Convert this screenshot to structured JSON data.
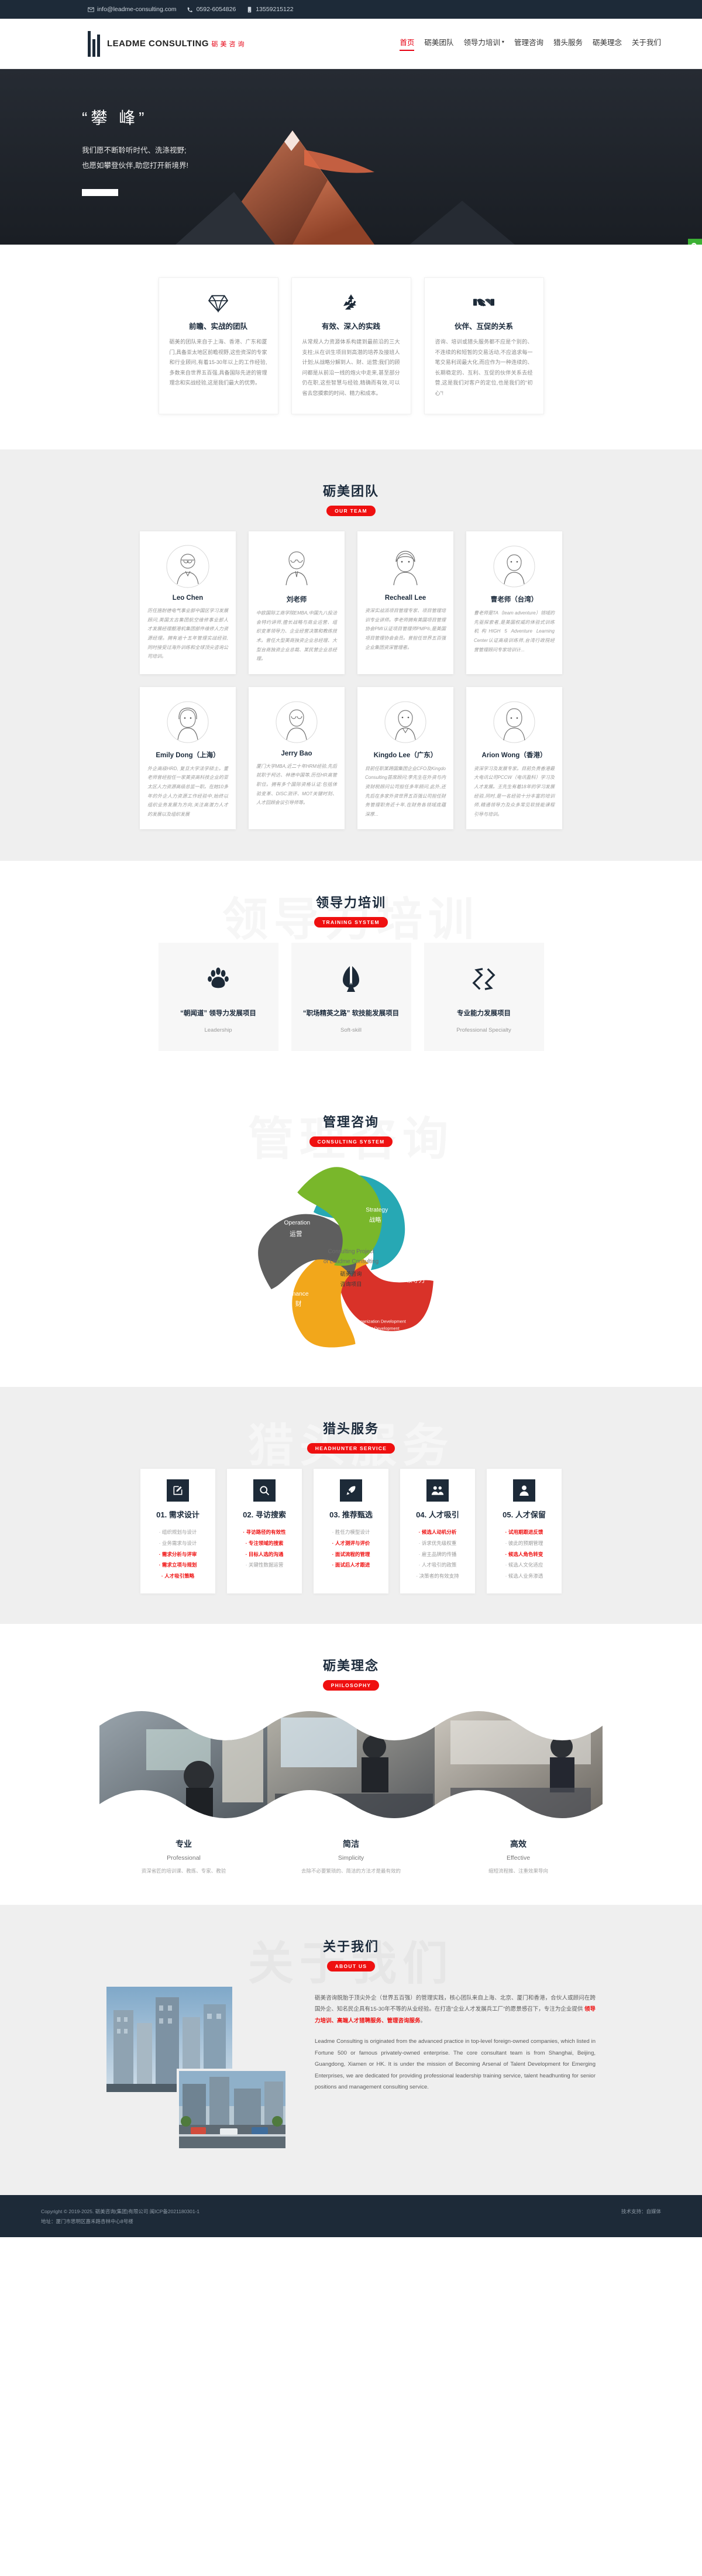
{
  "topbar": {
    "email": "info@leadme-consulting.com",
    "phone": "0592-6054826",
    "mobile": "13559215122"
  },
  "brand": {
    "en": "LEADME CONSULTING",
    "cn": "砺美咨询"
  },
  "nav": [
    {
      "label": "首页",
      "active": true,
      "caret": false
    },
    {
      "label": "砺美团队",
      "active": false,
      "caret": false
    },
    {
      "label": "领导力培训",
      "active": false,
      "caret": true
    },
    {
      "label": "管理咨询",
      "active": false,
      "caret": false
    },
    {
      "label": "猎头服务",
      "active": false,
      "caret": false
    },
    {
      "label": "砺美理念",
      "active": false,
      "caret": false
    },
    {
      "label": "关于我们",
      "active": false,
      "caret": false
    }
  ],
  "hero": {
    "title": "“攀 峰”",
    "line1": "我们愿不断聆听时代、洗涤视野;",
    "line2": "也愿如攀登伙伴,助您打开新境界!"
  },
  "sidefloat": [
    {
      "name": "wechat-icon"
    },
    {
      "name": "qq-icon"
    },
    {
      "name": "phone-icon"
    }
  ],
  "features": [
    {
      "icon": "diamond-icon",
      "title": "前瞻、实战的团队",
      "text": "砺美的团队来自于上海、香港、广东和厦门,具备亚太地区前瞻视野,这些资深的专家和行业顾问,有着15-30年以上的工作经验,多数来自世界五百强,具备国际先进的管理理念和实战经验,这是我们最大的优势。"
    },
    {
      "icon": "recycle-icon",
      "title": "有效、深入的实践",
      "text": "从常规人力资源体系构建到最前沿的三大支柱;从在训生项目到高潜的培养及接班人计划;从战略分解到人、财、运营;我们的顾问都是从前沿一线的炮火中走来,甚至部分仍在职,这些智慧与经验,精确而有效,可以省去您摸索的时间、精力和成本。"
    },
    {
      "icon": "handshake-icon",
      "title": "伙伴、互促的关系",
      "text": "咨询、培训或猎头服务都不应是个别的、不连续的和短暂的交易活动,不应追求每一笔交易利润最大化,而应作为一种连续的、长期稳定的、互利、互促的伙伴关系去经营,这是我们对客户的定位,也是我们的“初心”!"
    }
  ],
  "team": {
    "title": "砺美团队",
    "badge": "OUR TEAM",
    "members": [
      {
        "name": "Leo Chen",
        "bio": "历任施耐德电气事业部中国区学习发展顾问,英国太古集团航空维修事业部人才发展经理靓港机集团部件维修人力资源经理。拥有逾十五年管理实战经验,同时接受过海外训练和全球顶尖咨询公司培训。"
      },
      {
        "name": "刘老师",
        "bio": "中欧国际工商学院EMBA,中国九八投洽会特约讲师,擅长战略与商业运营、组织变革领导力、企业经营决策和教练技术。曾任大型美商独资企业总经理、大型台商独资企业总裁、某民营企业总经理。"
      },
      {
        "name": "Recheall Lee",
        "bio": "资深实战派项目管理专家、项目管理培训专业讲师。李老师拥有美国项目管理协会PMI认证项目管理师PMP®,是美国项目管理协会会员。曾担任世界五百强企业集团资深管理者。"
      },
      {
        "name": "曹老师（台湾）",
        "bio": "曹老师是TA（team adventure）领域的先驱探索者,是美国权威的体验式训练机构HIGH 5 Adventure Learning Center认证高级训练师,台湾行政院经营管理顾问专家培训计..."
      },
      {
        "name": "Emily Dong（上海）",
        "bio": "外企高级HRD, 复旦大学法学硕士。董老师曾经担任一家美资高科技企业的亚太区人力资源高级总监一职。在她10多年的外企人力资源工作经验中,始终以组织业务发展为方向,关注高潜力人才的发展以及组织发展"
      },
      {
        "name": "Jerry Bao",
        "bio": "厦门大学MBA,近二十年HRM经验,先后就职于柯达、林德中国等,历任HR高管职位。拥有多个国际资格认证:包括体验变革、DISC测评、MOT关键时刻、人才回顾会议引导师等。"
      },
      {
        "name": "Kingdo Lee（广东）",
        "bio": "目前任职某跨国集团企业CFO及Kingdo Consulting首席顾问;李先生在外资与内资财税顾问公司担任多年顾问,此外,还先后在多家外资世界五百强公司担任财务管理职务近十年,在财务各领域底蕴深厚..."
      },
      {
        "name": "Arion Wong（香港）",
        "bio": "资深学习及发展专家。目前负责香港最大电讯公司PCCW（电讯盈科）学习及人才发展。王先生有着18年的学习发展经验,同时,是一名经验十分丰富的培训师,精通领导力及众多常见软技能课程引导与培训。"
      }
    ]
  },
  "training": {
    "title": "领导力培训",
    "badge": "TRAINING SYSTEM",
    "watermark": "领导力培训",
    "items": [
      {
        "icon": "paw-icon",
        "name": "“朝闻道” 领导力发展项目",
        "en": "Leadership"
      },
      {
        "icon": "leaf-person-icon",
        "name": "“职场精英之路” 软技能发展项目",
        "en": "Soft-skill"
      },
      {
        "icon": "interlock-icon",
        "name": "专业能力发展项目",
        "en": "Professional Specialty"
      }
    ]
  },
  "consulting": {
    "title": "管理咨询",
    "badge": "CONSULTING SYSTEM",
    "watermark": "管理咨询",
    "center": {
      "en1": "Consulting Project",
      "en2": "of Leadme Consulting",
      "cn1": "砺美咨询",
      "cn2": "咨询项目"
    },
    "petals": [
      {
        "en": "Strategy",
        "cn": "战略",
        "color": "#27a8b4"
      },
      {
        "en": "Leadership",
        "cn": "领导力",
        "color": "#d93229"
      },
      {
        "en": "Organization Development & Talent Development",
        "cn": "组织与人才",
        "color": "#f2a71b"
      },
      {
        "en": "Finance",
        "cn": "财",
        "color": "#5e5e5e"
      },
      {
        "en": "Operation",
        "cn": "运营",
        "color": "#79b72b"
      }
    ]
  },
  "headhunter": {
    "title": "猎头服务",
    "badge": "HEADHUNTER SERVICE",
    "watermark": "猎头服务",
    "steps": [
      {
        "icon": "edit-square-icon",
        "title": "01. 需求设计",
        "items": [
          {
            "text": "组织规划与设计",
            "hi": false
          },
          {
            "text": "业务需求与设计",
            "hi": false
          },
          {
            "text": "需求分析与评审",
            "hi": true
          },
          {
            "text": "需求立项与规划",
            "hi": true
          },
          {
            "text": "人才吸引策略",
            "hi": true
          }
        ]
      },
      {
        "icon": "search-icon",
        "title": "02. 寻访搜索",
        "items": [
          {
            "text": "寻访路径的有效性",
            "hi": true
          },
          {
            "text": "专注领域的搜索",
            "hi": true
          },
          {
            "text": "目标人选的沟通",
            "hi": true
          },
          {
            "text": "关键性数据运营",
            "hi": false
          }
        ]
      },
      {
        "icon": "rocket-icon",
        "title": "03. 推荐甄选",
        "items": [
          {
            "text": "胜任力模型设计",
            "hi": false
          },
          {
            "text": "人才测评与评价",
            "hi": true
          },
          {
            "text": "面试流程的管理",
            "hi": true
          },
          {
            "text": "面试后人才跟进",
            "hi": true
          }
        ]
      },
      {
        "icon": "users-icon",
        "title": "04. 人才吸引",
        "items": [
          {
            "text": "候选人动机分析",
            "hi": true
          },
          {
            "text": "诉求优先级权重",
            "hi": false
          },
          {
            "text": "雇主品牌的传播",
            "hi": false
          },
          {
            "text": "人才吸引的政策",
            "hi": false
          },
          {
            "text": "决策者的有效支持",
            "hi": false
          }
        ]
      },
      {
        "icon": "user-icon",
        "title": "05. 人才保留",
        "items": [
          {
            "text": "试用期跟进反馈",
            "hi": true
          },
          {
            "text": "彼此的预期管理",
            "hi": false
          },
          {
            "text": "候选人角色转变",
            "hi": true
          },
          {
            "text": "候选人文化适应",
            "hi": false
          },
          {
            "text": "候选人业务渗透",
            "hi": false
          }
        ]
      }
    ]
  },
  "philosophy": {
    "title": "砺美理念",
    "badge": "PHILOSOPHY",
    "items": [
      {
        "cn": "专业",
        "en": "Professional",
        "desc": "资深省匠的培训课、教练、专家、教验"
      },
      {
        "cn": "简洁",
        "en": "Simplicity",
        "desc": "去除不必要繁琐的、简洁的方法才是最有效的"
      },
      {
        "cn": "高效",
        "en": "Effective",
        "desc": "缩短流程推、注重效果导向"
      }
    ]
  },
  "about": {
    "title": "关于我们",
    "badge": "ABOUT US",
    "watermark": "关于我们",
    "cn_before": "砺美咨询脱胎于顶尖外企（世界五百强）的管理实践，核心团队来自上海、北京、厦门和香港，合伙人或顾问在跨国外企、知名民企具有15-30年不等的从业经验。在打造“企业人才发展兵工厂”的愿景感召下，专注为企业提供 ",
    "cn_highlight": "领导力培训、高端人才猎聘服务、管理咨询服务",
    "cn_after": "。",
    "en": "Leadme Consulting  is originated from  the advanced practice in top-level foreign-owned companies, which listed in Fortune 500 or famous privately-owned enterprise. The core consultant team is from Shanghai, Beijing, Guangdong, Xiamen or HK. It is under the mission of Becoming Arsenal of Talent Development for Emerging Enterprises, we are dedicated for providing professional leadership training service, talent headhunting for senior positions and management consulting service."
  },
  "footer": {
    "copyright": "Copyright © 2019-2025. 砺美咨询(集团)有限公司  闽ICP备2021180301-1",
    "address": "地址：厦门市思明区嘉禾路杏林中心8号楼",
    "support": "技术支持：自媒体"
  }
}
